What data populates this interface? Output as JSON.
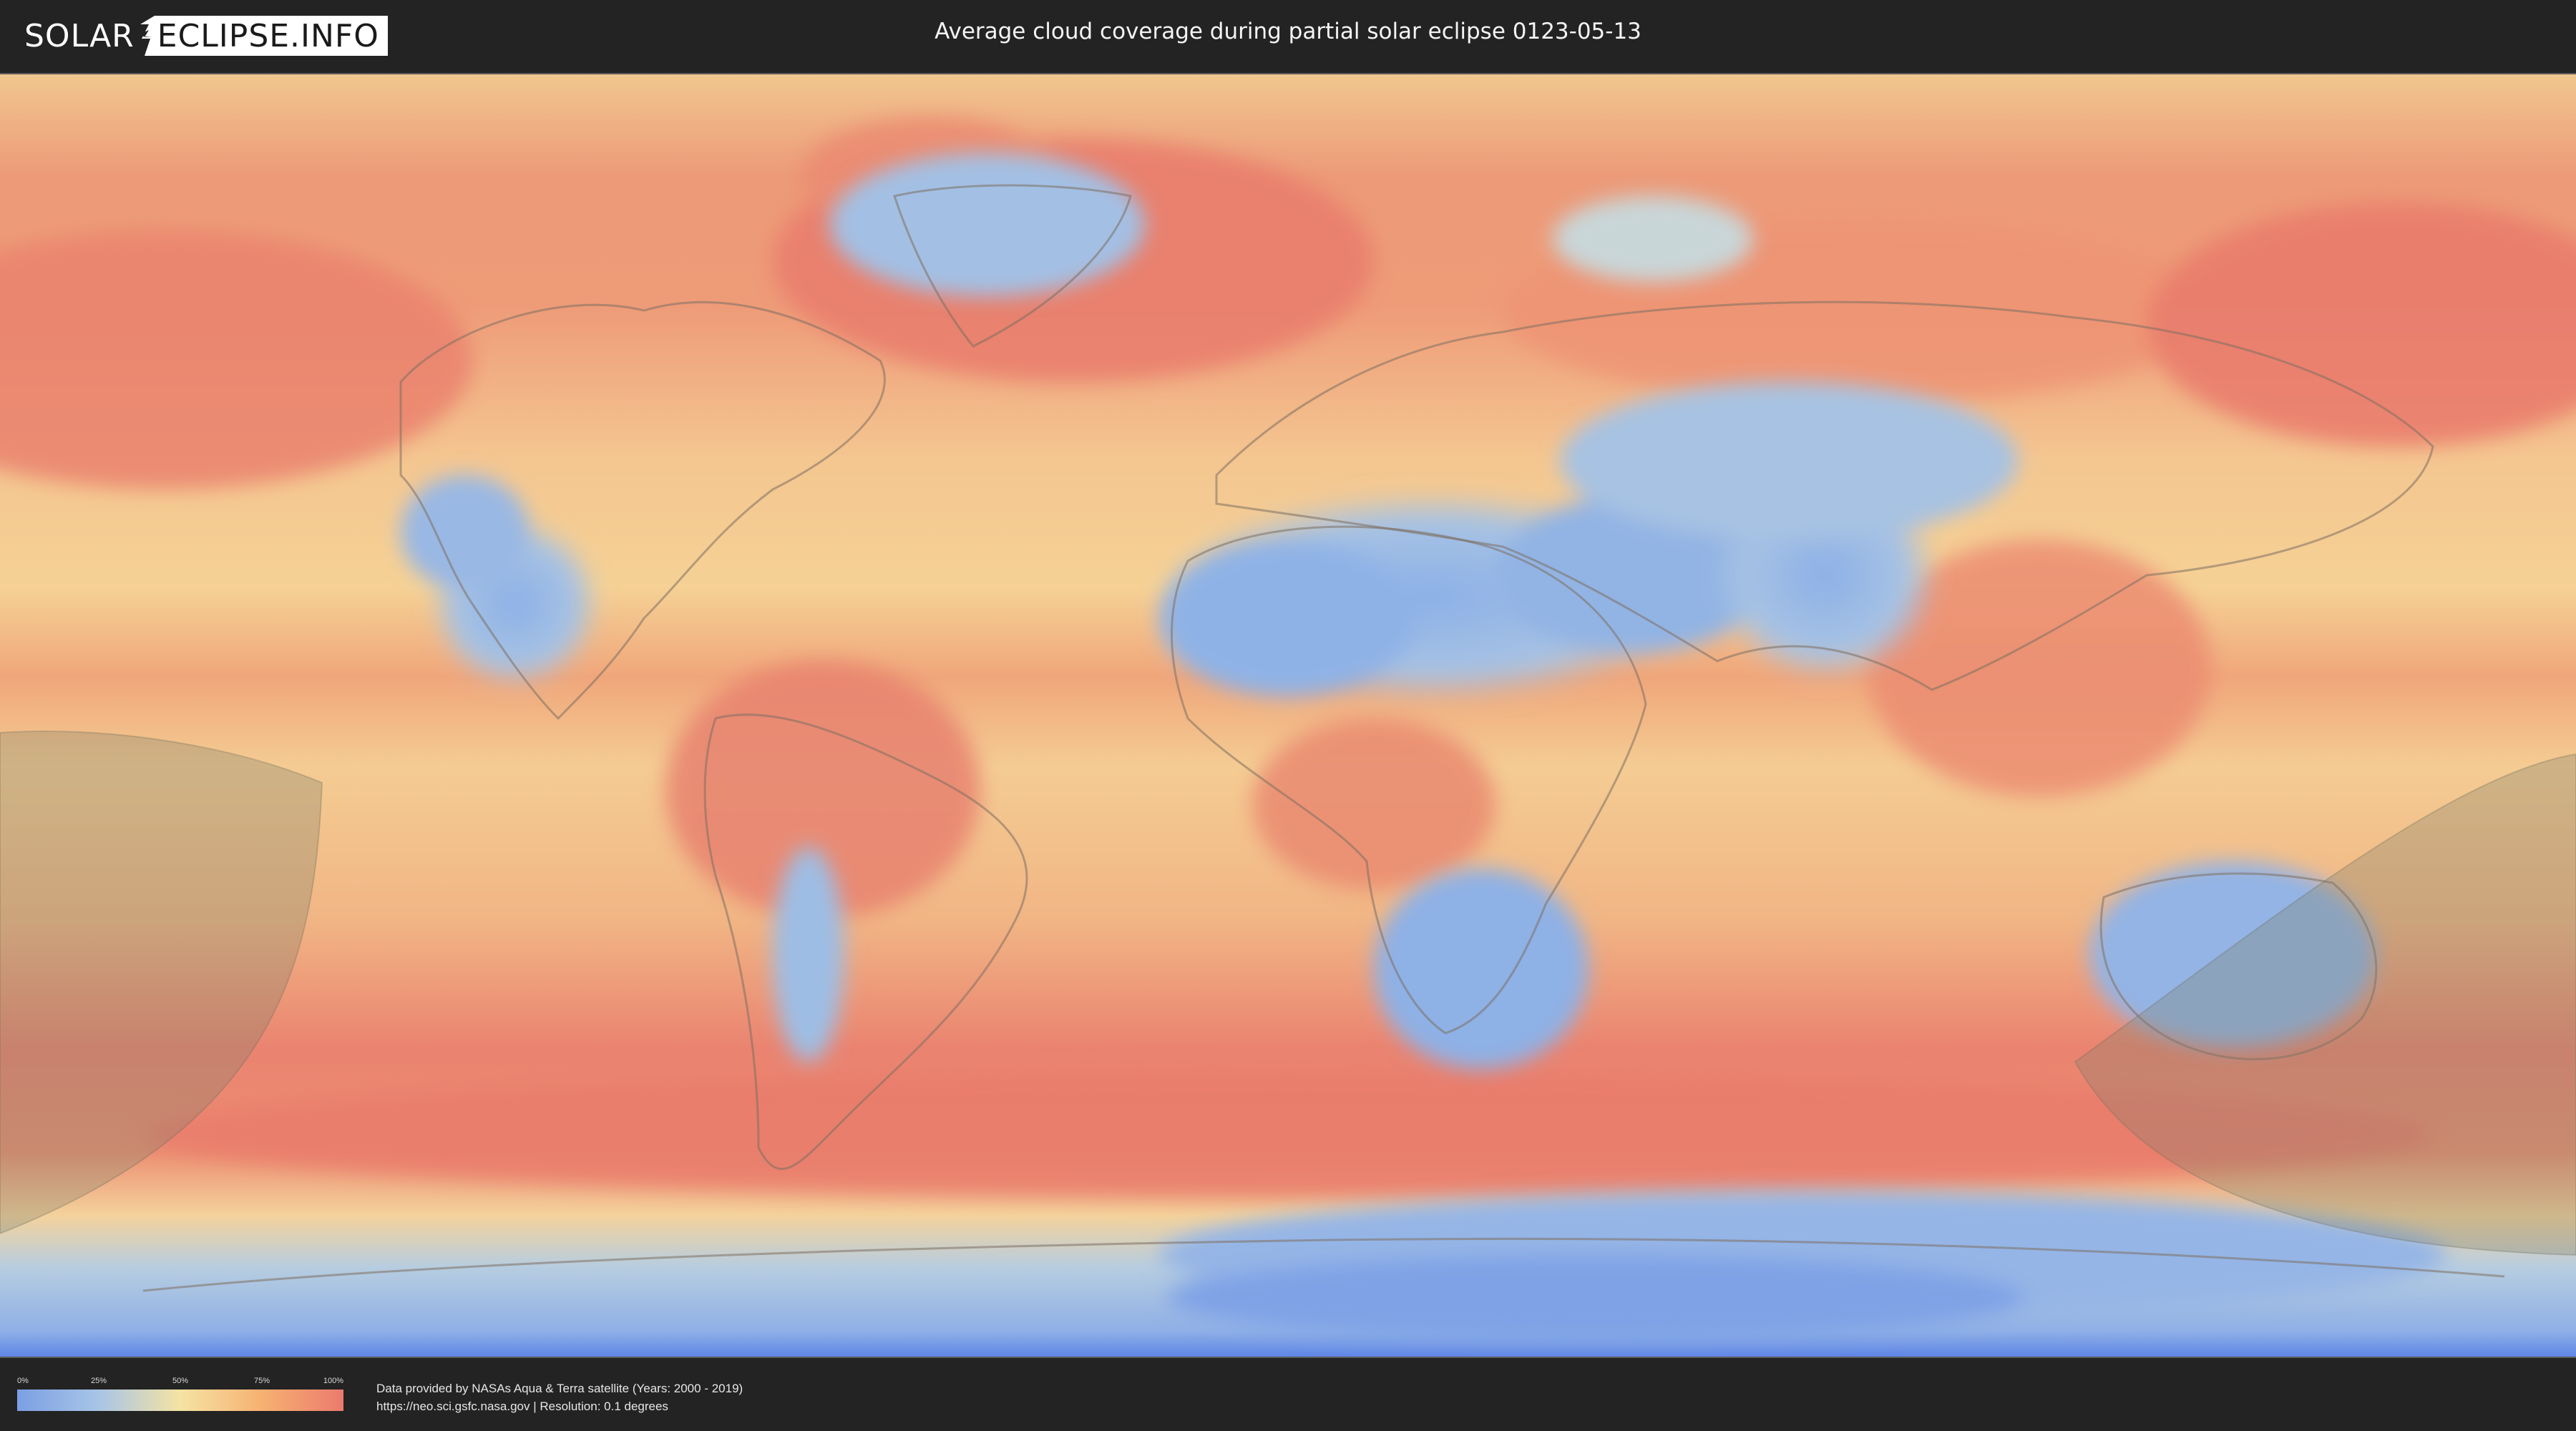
{
  "header": {
    "logo_left": "SOLAR",
    "logo_right": "ECLIPSE.INFO",
    "title": "Average cloud coverage during partial solar eclipse 0123-05-13"
  },
  "legend": {
    "ticks": [
      "0%",
      "25%",
      "50%",
      "75%",
      "100%"
    ],
    "gradient_colors": [
      "#7b9fe4",
      "#a8c5e6",
      "#f5e3a3",
      "#f6b171",
      "#ec7a6d"
    ]
  },
  "source": {
    "line1": "Data provided by NASAs Aqua & Terra satellite (Years: 2000 - 2019)",
    "line2": "https://neo.sci.gsfc.nasa.gov | Resolution: 0.1 degrees"
  },
  "map": {
    "colors": {
      "clear": "#8fb3e8",
      "partly": "#f5d59a",
      "cloudy": "#ec8a72",
      "ice": "#5f86e6",
      "eclipse_shade": "#8a8a70"
    }
  }
}
